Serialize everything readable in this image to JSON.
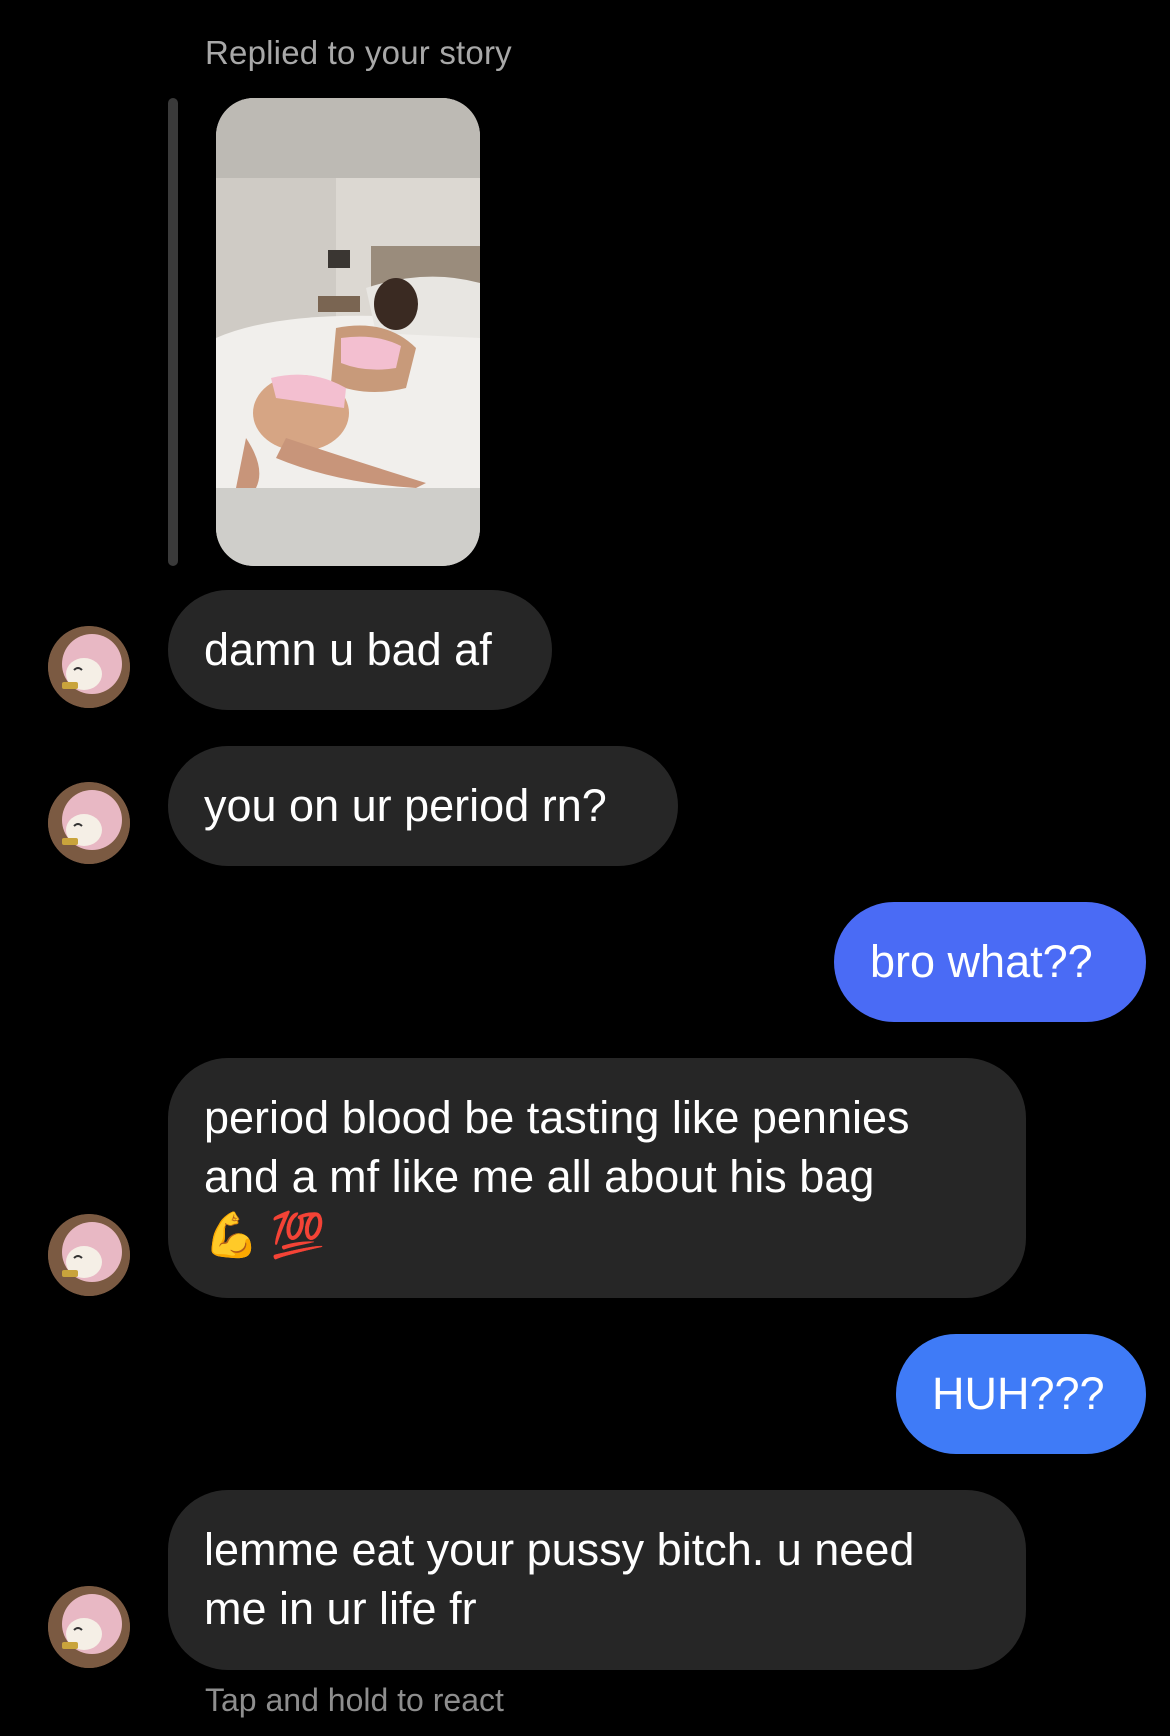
{
  "reply_header": "Replied to your story",
  "story": {
    "image": "story-photo"
  },
  "messages": [
    {
      "from": "them",
      "lines": [
        "damn u bad af"
      ]
    },
    {
      "from": "them",
      "lines": [
        "you on ur period rn?"
      ]
    },
    {
      "from": "me",
      "lines": [
        "bro what??"
      ]
    },
    {
      "from": "them",
      "lines": [
        "period blood be tasting like pennies",
        "and a mf like me all about his bag"
      ],
      "emojis": [
        "💪",
        "💯"
      ]
    },
    {
      "from": "me",
      "lines": [
        "HUH???"
      ]
    },
    {
      "from": "them",
      "lines": [
        "lemme eat your pussy bitch. u need",
        "me in ur life fr"
      ]
    }
  ],
  "footer_hint": "Tap and hold to react",
  "colors": {
    "background": "#000000",
    "incoming_bubble": "#262626",
    "outgoing_bubble_1": "#4A6BF5",
    "outgoing_bubble_2": "#3F7BF7",
    "secondary_text": "#A8A8A8"
  }
}
